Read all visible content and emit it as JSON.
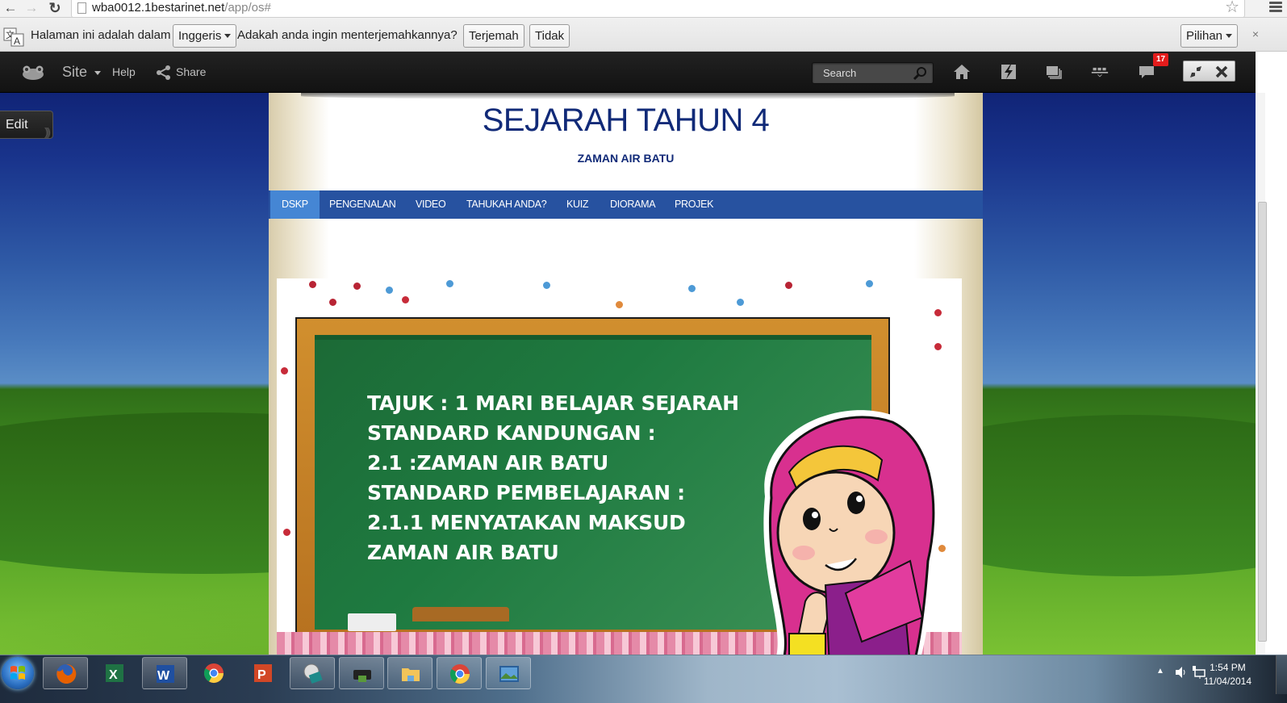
{
  "browser": {
    "url_host": "wba0012.1bestarinet.net",
    "url_path": "/app/os#",
    "back_icon": "arrow-left-icon",
    "forward_icon": "arrow-right-icon",
    "reload_icon": "reload-icon",
    "star_icon": "bookmark-star-icon",
    "menu_icon": "hamburger-menu-icon"
  },
  "translate_bar": {
    "prefix": "Halaman ini adalah dalam",
    "language": "Inggeris",
    "question": "Adakah anda ingin menterjemahkannya?",
    "translate_button": "Terjemah",
    "no_button": "Tidak",
    "options_button": "Pilihan",
    "close": "×"
  },
  "toolbar": {
    "site_label": "Site",
    "help_label": "Help",
    "share_label": "Share",
    "search_placeholder": "Search",
    "notification_count": "17",
    "icons": [
      "frog-logo-icon",
      "home-icon",
      "lightning-icon",
      "folders-icon",
      "apps-tray-icon",
      "chat-icon",
      "collapse-icon",
      "close-icon"
    ]
  },
  "edit_tab": {
    "label": "Edit"
  },
  "page": {
    "title": "SEJARAH TAHUN 4",
    "subtitle": "ZAMAN AIR BATU",
    "nav": [
      {
        "label": "DSKP",
        "active": true
      },
      {
        "label": "PENGENALAN",
        "active": false
      },
      {
        "label": "VIDEO",
        "active": false
      },
      {
        "label": "TAHUKAH ANDA?",
        "active": false
      },
      {
        "label": "KUIZ",
        "active": false
      },
      {
        "label": "DIORAMA",
        "active": false
      },
      {
        "label": "PROJEK",
        "active": false
      }
    ],
    "board_lines": [
      "TAJUK : 1 MARI BELAJAR SEJARAH",
      "STANDARD KANDUNGAN :",
      "2.1 :ZAMAN AIR BATU",
      "STANDARD PEMBELAJARAN :",
      "2.1.1 MENYATAKAN MAKSUD",
      "ZAMAN AIR BATU"
    ],
    "colors": {
      "title": "#112a78",
      "nav_bg": "#2752a0",
      "nav_active": "#4586d4",
      "board": "#1e7a40"
    }
  },
  "taskbar": {
    "apps": [
      {
        "name": "firefox",
        "icon": "firefox-icon",
        "open": true
      },
      {
        "name": "excel",
        "icon": "excel-icon",
        "open": false
      },
      {
        "name": "word",
        "icon": "word-icon",
        "open": true
      },
      {
        "name": "chrome",
        "icon": "chrome-icon",
        "open": false
      },
      {
        "name": "powerpoint",
        "icon": "powerpoint-icon",
        "open": false
      },
      {
        "name": "cd-book",
        "icon": "cd-book-icon",
        "open": true
      },
      {
        "name": "printer",
        "icon": "printer-icon",
        "open": true
      },
      {
        "name": "explorer",
        "icon": "folder-icon",
        "open": true
      },
      {
        "name": "chrome-window",
        "icon": "chrome-icon",
        "open": true
      },
      {
        "name": "photo-viewer",
        "icon": "photo-viewer-icon",
        "open": true
      }
    ],
    "time": "1:54 PM",
    "date": "11/04/2014"
  }
}
